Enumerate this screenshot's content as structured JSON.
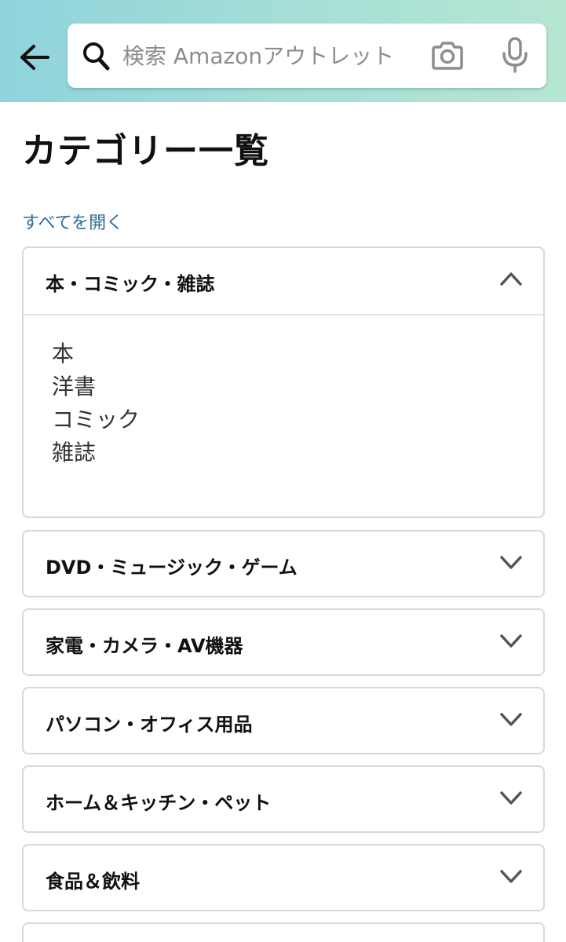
{
  "header": {
    "back_icon": "arrow-left-icon",
    "search": {
      "placeholder": "検索 Amazonアウトレット",
      "value": "",
      "search_icon": "search-icon",
      "camera_icon": "camera-icon",
      "mic_icon": "microphone-icon"
    },
    "gradient_colors": [
      "#8fd3dc",
      "#b6e6d2"
    ]
  },
  "page": {
    "title": "カテゴリー一覧",
    "expand_all_label": "すべてを開く",
    "link_color": "#2a6d96"
  },
  "categories": [
    {
      "label": "本・コミック・雑誌",
      "expanded": true,
      "chevron": "chevron-up-icon",
      "items": [
        "本",
        "洋書",
        "コミック",
        "雑誌"
      ]
    },
    {
      "label": "DVD・ミュージック・ゲーム",
      "expanded": false,
      "chevron": "chevron-down-icon"
    },
    {
      "label": "家電・カメラ・AV機器",
      "expanded": false,
      "chevron": "chevron-down-icon"
    },
    {
      "label": "パソコン・オフィス用品",
      "expanded": false,
      "chevron": "chevron-down-icon"
    },
    {
      "label": "ホーム＆キッチン・ペット",
      "expanded": false,
      "chevron": "chevron-down-icon"
    },
    {
      "label": "食品＆飲料",
      "expanded": false,
      "chevron": "chevron-down-icon"
    }
  ]
}
